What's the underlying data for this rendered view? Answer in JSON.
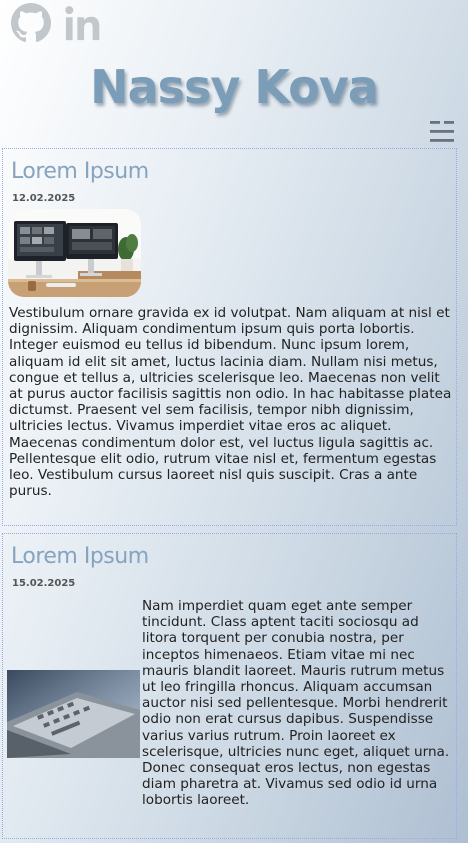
{
  "header": {
    "brand": "Nassy Kova",
    "social": [
      {
        "icon": "github-icon"
      },
      {
        "icon": "linkedin-icon"
      }
    ],
    "menu_icon": "menu-icon"
  },
  "posts": [
    {
      "title": "Lorem Ipsum",
      "date": "12.02.2025",
      "image": "desk-computer-image",
      "text": "Vestibulum ornare gravida ex id volutpat. Nam aliquam at nisl et dignissim. Aliquam condimentum ipsum quis porta lobortis. Integer euismod eu tellus id bibendum. Nunc ipsum lorem, aliquam id elit sit amet, luctus lacinia diam. Nullam nisi metus, congue et tellus a, ultricies scelerisque leo. Maecenas non velit at purus auctor facilisis sagittis non odio. In hac habitasse platea dictumst. Praesent vel sem facilisis, tempor nibh dignissim, ultricies lectus. Vivamus imperdiet vitae eros ac aliquet. Maecenas condimentum dolor est, vel luctus ligula sagittis ac. Pellentesque elit odio, rutrum vitae nisl et, fermentum egestas leo. Vestibulum cursus laoreet nisl quis suscipit. Cras a ante purus."
    },
    {
      "title": "Lorem Ipsum",
      "date": "15.02.2025",
      "image": "laptop-keyboard-image",
      "text": "Nam imperdiet quam eget ante semper tincidunt. Class aptent taciti sociosqu ad litora torquent per conubia nostra, per inceptos himenaeos. Etiam vitae mi nec mauris blandit laoreet. Mauris rutrum metus ut leo fringilla rhoncus. Aliquam accumsan auctor nisi sed pellentesque. Morbi hendrerit odio non erat cursus dapibus. Suspendisse varius varius rutrum. Proin laoreet ex scelerisque, ultricies nunc eget, aliquet urna. Donec consequat eros lectus, non egestas diam pharetra at. Vivamus sed odio id urna lobortis laoreet."
    }
  ],
  "colors": {
    "brand": "#7c9db8",
    "post_title": "#86a3bf",
    "border": "#98a9e6"
  }
}
